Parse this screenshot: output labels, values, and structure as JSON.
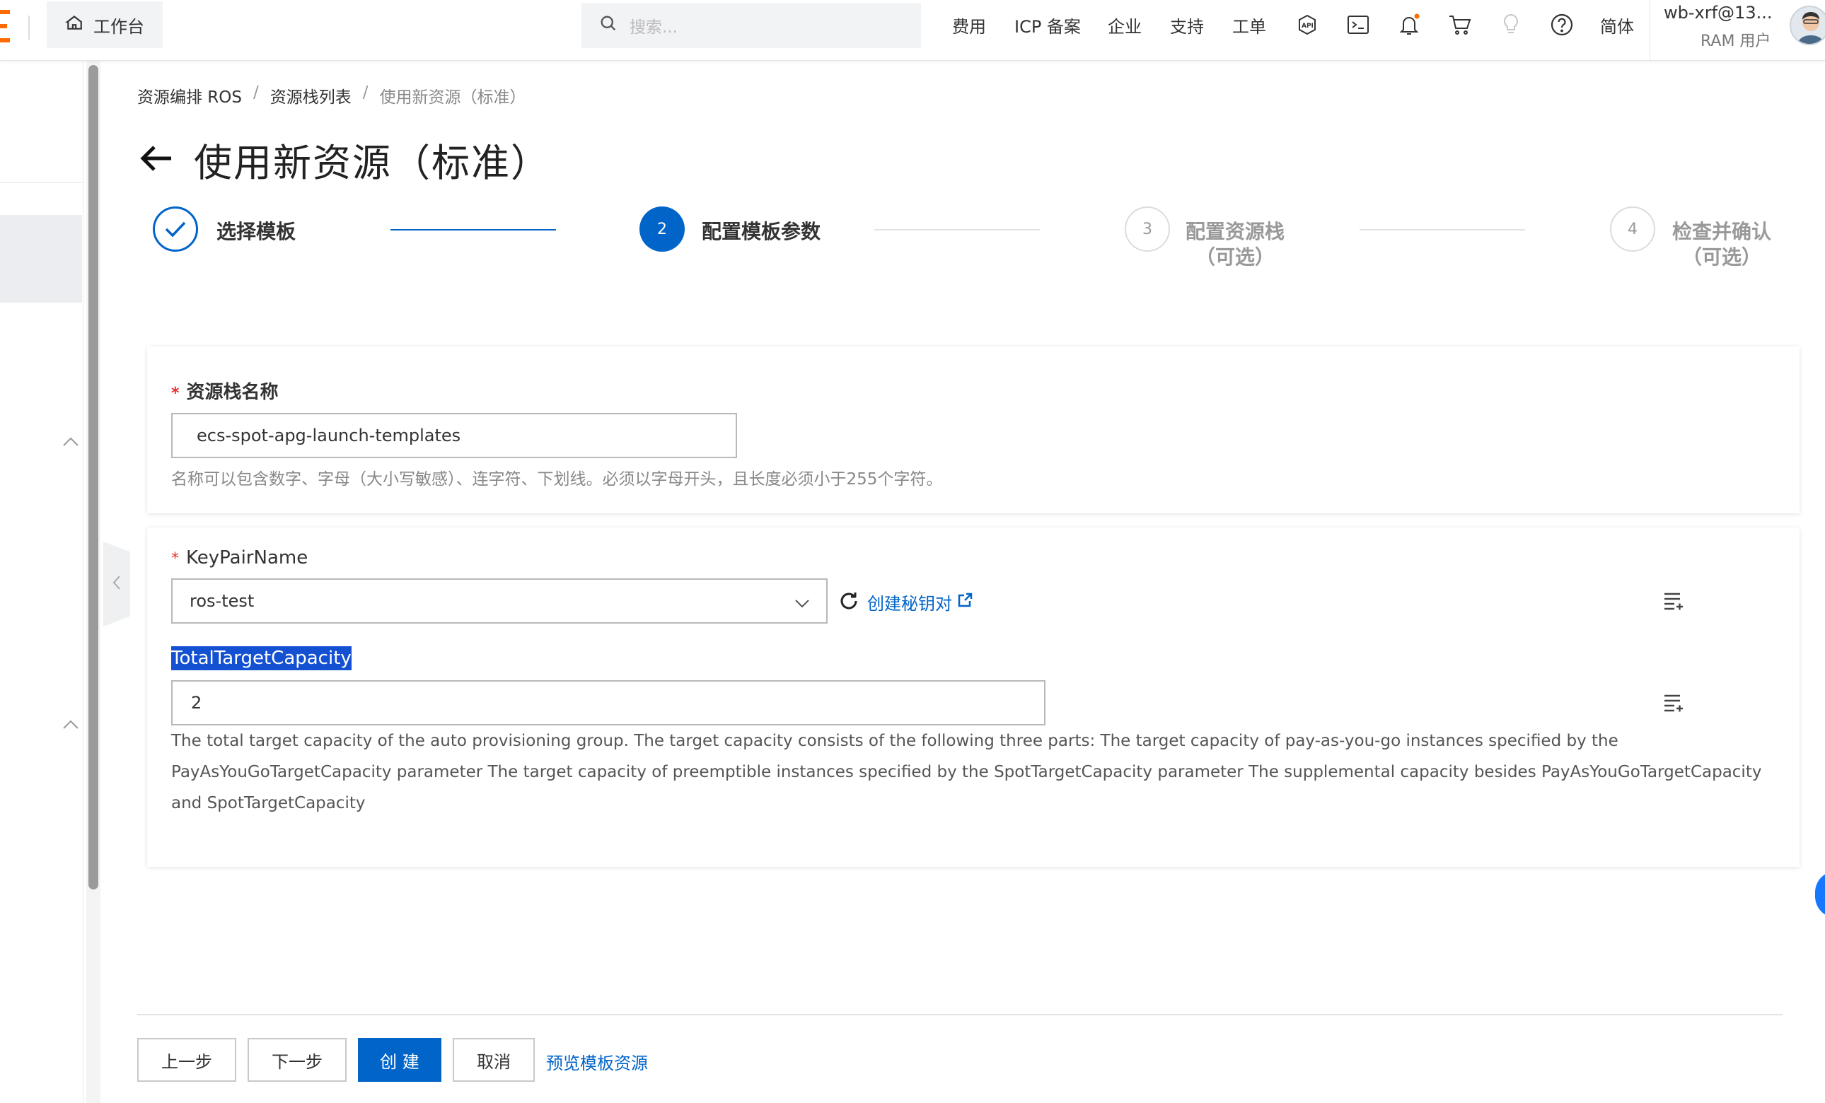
{
  "topbar": {
    "workbench_label": "工作台",
    "search_placeholder": "搜索...",
    "nav": [
      "费用",
      "ICP 备案",
      "企业",
      "支持",
      "工单"
    ],
    "lang_label": "简体",
    "user_name": "wb-xrf@13...",
    "user_role": "RAM 用户",
    "icons": [
      "api-icon",
      "terminal-icon",
      "bell-icon",
      "cart-icon",
      "lightbulb-icon",
      "help-icon"
    ],
    "accent_color": "#ff6a00"
  },
  "breadcrumb": [
    "资源编排 ROS",
    "资源栈列表",
    "使用新资源（标准）"
  ],
  "page_title": "使用新资源（标准）",
  "steps": [
    {
      "number": "",
      "label": "选择模板",
      "sub": "",
      "status": "done"
    },
    {
      "number": "2",
      "label": "配置模板参数",
      "sub": "",
      "status": "active"
    },
    {
      "number": "3",
      "label": "配置资源栈",
      "sub": "（可选）",
      "status": "pending"
    },
    {
      "number": "4",
      "label": "检查并确认",
      "sub": "（可选）",
      "status": "pending"
    }
  ],
  "stack_name": {
    "label": "资源栈名称",
    "value": "ecs-spot-apg-launch-templates",
    "help": "名称可以包含数字、字母（大小写敏感）、连字符、下划线。必须以字母开头，且长度必须小于255个字符。"
  },
  "key_pair": {
    "label": "KeyPairName",
    "value": "ros-test",
    "create_link": "创建秘钥对"
  },
  "total_capacity": {
    "label": "TotalTargetCapacity",
    "value": "2",
    "description_lines": [
      "The total target capacity of the auto provisioning group. The target capacity consists of the following three parts: The target capacity of pay-as-you-go instances specified by the",
      "PayAsYouGoTargetCapacity parameter The target capacity of preemptible instances specified by the SpotTargetCapacity parameter The supplemental capacity besides PayAsYouGoTargetCapacity",
      "and SpotTargetCapacity"
    ]
  },
  "footer": {
    "prev_label": "上一步",
    "next_label": "下一步",
    "create_label": "创 建",
    "cancel_label": "取消",
    "preview_label": "预览模板资源"
  },
  "colors": {
    "primary": "#0064c8",
    "required": "#e0302f",
    "highlight": "#1450d2"
  }
}
